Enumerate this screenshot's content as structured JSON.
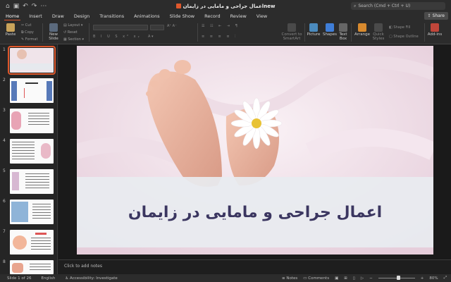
{
  "window": {
    "title": "اعمال جراحی و مامایی در زایمانnew"
  },
  "search": {
    "placeholder": "Search (Cmd + Ctrl + U)"
  },
  "menu": {
    "tabs": [
      "Home",
      "Insert",
      "Draw",
      "Design",
      "Transitions",
      "Animations",
      "Slide Show",
      "Record",
      "Review",
      "View"
    ],
    "active": "Home",
    "share": "Share"
  },
  "ribbon": {
    "paste": "Paste",
    "cut": "Cut",
    "copy": "Copy",
    "format": "Format",
    "new_slide": "New\nSlide",
    "layout": "Layout",
    "reset": "Reset",
    "section": "Section",
    "convert": "Convert to\nSmartArt",
    "picture": "Picture",
    "shapes": "Shapes",
    "text_box": "Text\nBox",
    "arrange": "Arrange",
    "quick_styles": "Quick\nStyles",
    "shape_fill": "Shape Fill",
    "shape_outline": "Shape Outline",
    "add_ins": "Add-ins"
  },
  "thumbnails": [
    {
      "n": "1"
    },
    {
      "n": "2"
    },
    {
      "n": "3"
    },
    {
      "n": "4"
    },
    {
      "n": "5"
    },
    {
      "n": "6"
    },
    {
      "n": "7"
    },
    {
      "n": "8"
    }
  ],
  "slide": {
    "title": "اعمال جراحی و مامایی در زایمان"
  },
  "notes": {
    "placeholder": "Click to add notes"
  },
  "status": {
    "slide": "Slide 1 of 26",
    "language": "English",
    "accessibility": "Accessibility: Investigate",
    "notes": "Notes",
    "comments": "Comments",
    "zoom": "80%"
  },
  "colors": {
    "accent": "#e0582c",
    "title_text": "#3b3660"
  }
}
